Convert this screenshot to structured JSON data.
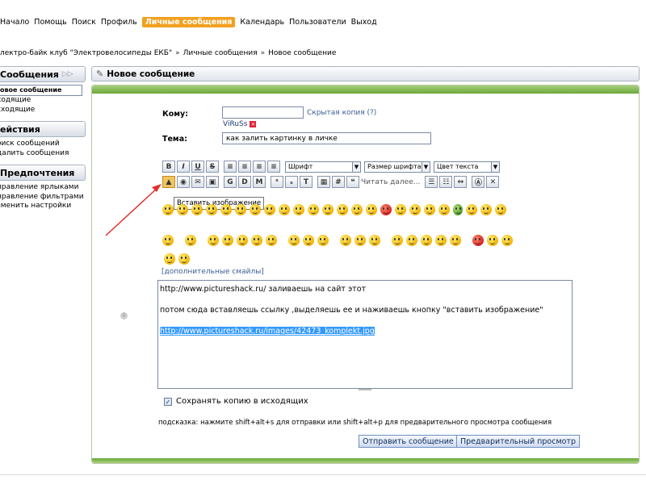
{
  "topnav": {
    "items": [
      "Начало",
      "Помощь",
      "Поиск",
      "Профиль",
      "Личные сообщения",
      "Календарь",
      "Пользователи",
      "Выход"
    ],
    "active_index": 4
  },
  "breadcrumb": {
    "items": [
      "лектро-байк клуб \"Электровелосипеды ЕКБ\"",
      "Личные сообщения",
      "Новое сообщение"
    ],
    "separator": "»"
  },
  "sidebar": {
    "messages": {
      "title": "Сообщения",
      "items": [
        "овое сообщение",
        "ходящие",
        "сходящие"
      ]
    },
    "actions": {
      "title": "ействия",
      "items": [
        "оиск сообщений",
        "далить сообщения"
      ]
    },
    "prefs": {
      "title": "Предпочтения",
      "items": [
        "правление ярлыками",
        "правление фильтрами",
        "зменить настройки"
      ]
    }
  },
  "panel": {
    "title": "Новое сообщение"
  },
  "form": {
    "to_label": "Кому:",
    "to_value": "",
    "bcc_link": "Скрытая копия (?)",
    "recipient": "ViRuSs",
    "subject_label": "Тема:",
    "subject_value": "как залить картинку в личке"
  },
  "toolbar": {
    "font_select": "Шрифт",
    "size_select": "Размер шрифта",
    "color_select": "Цвет текста",
    "quote_placeholder": "Читать далее..."
  },
  "tooltip": "Вставить изображение",
  "more_smileys": "[дополнительные смайлы]",
  "editor": {
    "line1": "http://www.pictureshack.ru/ заливаешь на сайт этот",
    "line2": "потом сюда вставляешь ссылку ,выделяешь ее и наживаешь кнопку \"вставить изображение\"",
    "line3": "http://www.pictureshack.ru/images/42473_komplekt.jpg"
  },
  "save_copy": {
    "label": "Сохранять копию в исходящих",
    "checked": true
  },
  "hint": "подсказка: нажмите shift+alt+s для отправки или shift+alt+p для предварительного просмотра сообщения",
  "buttons": {
    "send": "Отправить сообщение",
    "preview": "Предварительный просмотр"
  },
  "colors": {
    "accent": "#f2a01f",
    "panel_green": "#6aa83a",
    "link": "#3b5d96"
  }
}
